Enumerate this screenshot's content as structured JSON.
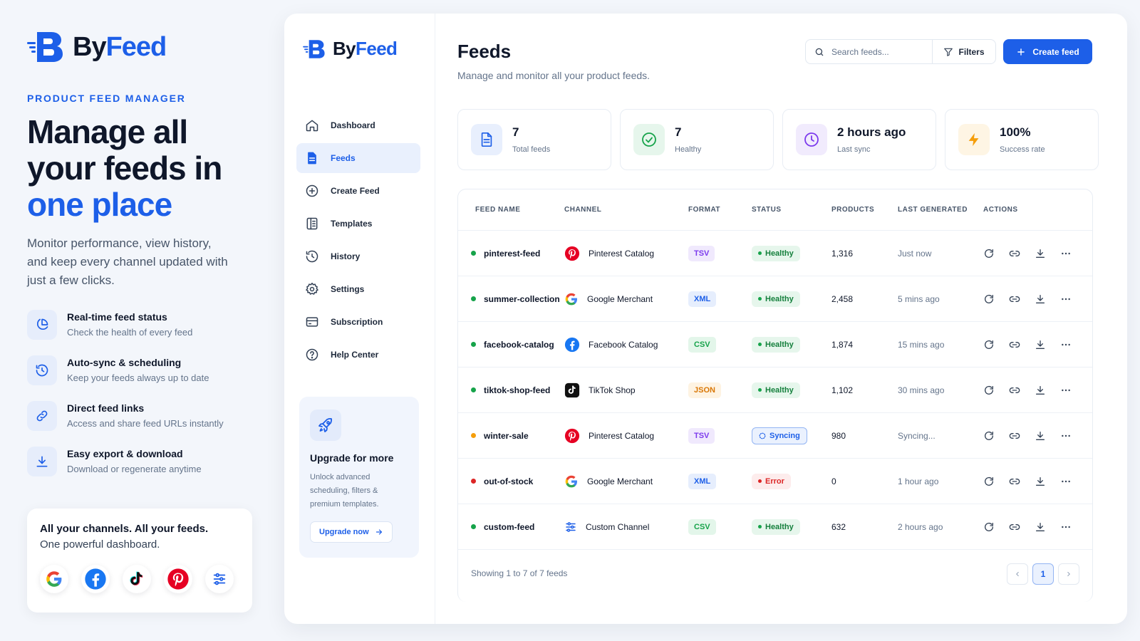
{
  "promo": {
    "brand_by": "By",
    "brand_feed": "Feed",
    "eyebrow": "PRODUCT FEED MANAGER",
    "headline_1": "Manage all",
    "headline_2": "your feeds in",
    "headline_accent": "one place",
    "description": "Monitor performance, view history, and keep every channel updated with just a few clicks.",
    "features": [
      {
        "icon": "pie-chart-icon",
        "title": "Real-time feed status",
        "subtitle": "Check the health of every feed"
      },
      {
        "icon": "history-clock-icon",
        "title": "Auto-sync & scheduling",
        "subtitle": "Keep your feeds always up to date"
      },
      {
        "icon": "link-icon",
        "title": "Direct feed links",
        "subtitle": "Access and share feed URLs instantly"
      },
      {
        "icon": "download-icon",
        "title": "Easy export & download",
        "subtitle": "Download or regenerate anytime"
      }
    ],
    "channels_line1": "All your channels. All your feeds.",
    "channels_line2": "One powerful dashboard.",
    "channel_icons": [
      "google-icon",
      "facebook-icon",
      "tiktok-icon",
      "pinterest-icon",
      "custom-channel-icon"
    ]
  },
  "sidebar": {
    "brand_by": "By",
    "brand_feed": "Feed",
    "items": [
      {
        "label": "Dashboard",
        "icon": "home-icon"
      },
      {
        "label": "Feeds",
        "icon": "file-icon",
        "active": true
      },
      {
        "label": "Create Feed",
        "icon": "plus-circle-icon"
      },
      {
        "label": "Templates",
        "icon": "template-icon"
      },
      {
        "label": "History",
        "icon": "history-icon"
      },
      {
        "label": "Settings",
        "icon": "gear-icon"
      },
      {
        "label": "Subscription",
        "icon": "card-icon"
      },
      {
        "label": "Help Center",
        "icon": "help-icon"
      }
    ],
    "upgrade": {
      "title": "Upgrade for more",
      "text": "Unlock advanced scheduling, filters & premium templates.",
      "button": "Upgrade now"
    }
  },
  "header": {
    "title": "Feeds",
    "subtitle": "Manage and monitor all your product feeds.",
    "search_placeholder": "Search feeds...",
    "filters_label": "Filters",
    "create_label": "Create feed"
  },
  "stats": [
    {
      "value": "7",
      "label": "Total feeds",
      "icon": "document-icon"
    },
    {
      "value": "7",
      "label": "Healthy",
      "icon": "check-circle-icon"
    },
    {
      "value": "2 hours ago",
      "label": "Last sync",
      "icon": "clock-icon"
    },
    {
      "value": "100%",
      "label": "Success rate",
      "icon": "bolt-icon"
    }
  ],
  "table": {
    "columns": [
      "FEED NAME",
      "CHANNEL",
      "FORMAT",
      "STATUS",
      "PRODUCTS",
      "LAST GENERATED",
      "ACTIONS"
    ],
    "rows": [
      {
        "name": "pinterest-feed",
        "channel": "Pinterest Catalog",
        "channel_icon": "pinterest",
        "format": "TSV",
        "status": "Healthy",
        "products": "1,316",
        "last": "Just now"
      },
      {
        "name": "summer-collection",
        "channel": "Google Merchant",
        "channel_icon": "google",
        "format": "XML",
        "status": "Healthy",
        "products": "2,458",
        "last": "5 mins ago"
      },
      {
        "name": "facebook-catalog",
        "channel": "Facebook Catalog",
        "channel_icon": "facebook",
        "format": "CSV",
        "status": "Healthy",
        "products": "1,874",
        "last": "15 mins ago"
      },
      {
        "name": "tiktok-shop-feed",
        "channel": "TikTok Shop",
        "channel_icon": "tiktok",
        "format": "JSON",
        "status": "Healthy",
        "products": "1,102",
        "last": "30 mins ago"
      },
      {
        "name": "winter-sale",
        "channel": "Pinterest Catalog",
        "channel_icon": "pinterest",
        "format": "TSV",
        "status": "Syncing",
        "products": "980",
        "last": "Syncing..."
      },
      {
        "name": "out-of-stock",
        "channel": "Google Merchant",
        "channel_icon": "google",
        "format": "XML",
        "status": "Error",
        "products": "0",
        "last": "1 hour ago"
      },
      {
        "name": "custom-feed",
        "channel": "Custom Channel",
        "channel_icon": "custom",
        "format": "CSV",
        "status": "Healthy",
        "products": "632",
        "last": "2 hours ago"
      }
    ],
    "footer": "Showing 1 to 7 of 7 feeds",
    "current_page": "1"
  },
  "colors": {
    "accent": "#1d5fe8",
    "healthy": "#16a34a",
    "syncing": "#f59e0b",
    "error": "#dc2626"
  }
}
